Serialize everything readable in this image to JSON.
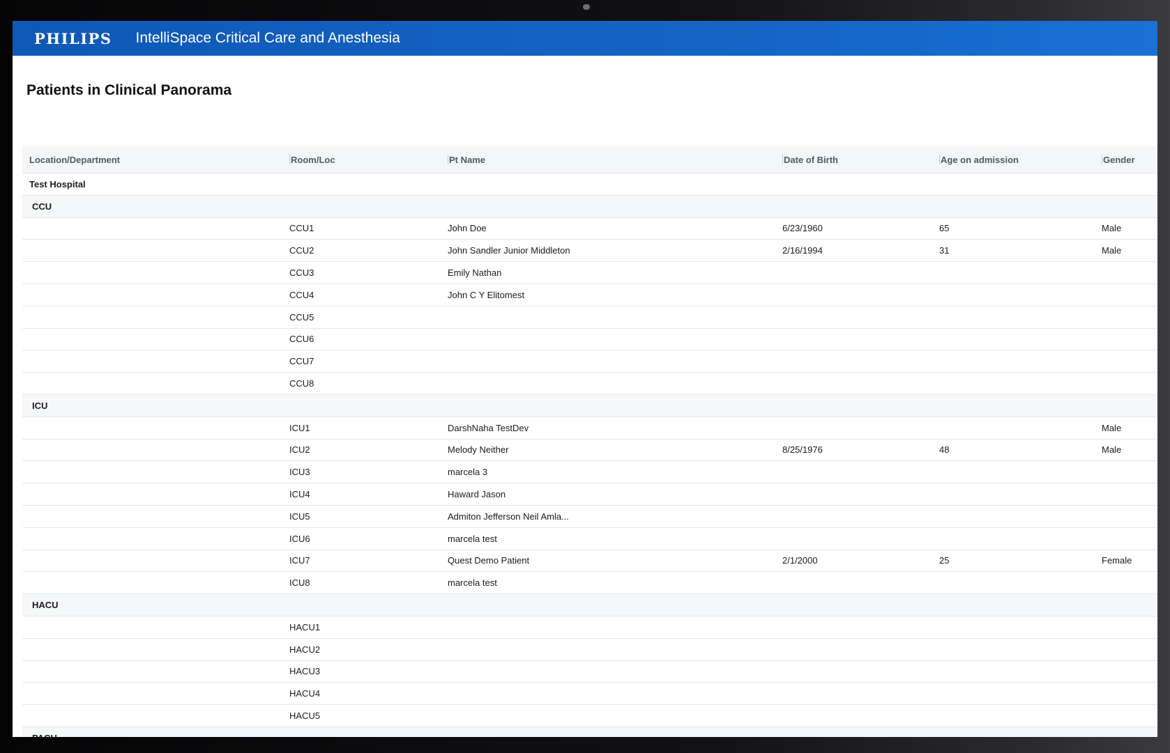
{
  "header": {
    "brand": "PHILIPS",
    "app_title": "IntelliSpace Critical Care and Anesthesia",
    "brand_color": "#1566c8"
  },
  "page_title": "Patients in Clinical Panorama",
  "table": {
    "columns": [
      "Location/Department",
      "Room/Loc",
      "Pt Name",
      "Date of Birth",
      "Age on admission",
      "Gender"
    ],
    "hospital": "Test Hospital",
    "groups": [
      {
        "name": "CCU",
        "rows": [
          {
            "room": "CCU1",
            "name": "John Doe",
            "dob": "6/23/1960",
            "age": "65",
            "gender": "Male"
          },
          {
            "room": "CCU2",
            "name": "John Sandler Junior Middleton",
            "dob": "2/16/1994",
            "age": "31",
            "gender": "Male"
          },
          {
            "room": "CCU3",
            "name": "Emily Nathan",
            "dob": "",
            "age": "",
            "gender": ""
          },
          {
            "room": "CCU4",
            "name": "John C Y Elitomest",
            "dob": "",
            "age": "",
            "gender": ""
          },
          {
            "room": "CCU5",
            "name": "",
            "dob": "",
            "age": "",
            "gender": ""
          },
          {
            "room": "CCU6",
            "name": "",
            "dob": "",
            "age": "",
            "gender": ""
          },
          {
            "room": "CCU7",
            "name": "",
            "dob": "",
            "age": "",
            "gender": ""
          },
          {
            "room": "CCU8",
            "name": "",
            "dob": "",
            "age": "",
            "gender": ""
          }
        ]
      },
      {
        "name": "ICU",
        "rows": [
          {
            "room": "ICU1",
            "name": "DarshNaha TestDev",
            "dob": "",
            "age": "",
            "gender": "Male"
          },
          {
            "room": "ICU2",
            "name": "Melody Neither",
            "dob": "8/25/1976",
            "age": "48",
            "gender": "Male"
          },
          {
            "room": "ICU3",
            "name": "marcela 3",
            "dob": "",
            "age": "",
            "gender": ""
          },
          {
            "room": "ICU4",
            "name": "Haward Jason",
            "dob": "",
            "age": "",
            "gender": ""
          },
          {
            "room": "ICU5",
            "name": "Admiton Jefferson Neil Amla...",
            "dob": "",
            "age": "",
            "gender": ""
          },
          {
            "room": "ICU6",
            "name": "marcela test",
            "dob": "",
            "age": "",
            "gender": ""
          },
          {
            "room": "ICU7",
            "name": "Quest Demo Patient",
            "dob": "2/1/2000",
            "age": "25",
            "gender": "Female"
          },
          {
            "room": "ICU8",
            "name": "marcela test",
            "dob": "",
            "age": "",
            "gender": ""
          }
        ]
      },
      {
        "name": "HACU",
        "rows": [
          {
            "room": "HACU1",
            "name": "",
            "dob": "",
            "age": "",
            "gender": ""
          },
          {
            "room": "HACU2",
            "name": "",
            "dob": "",
            "age": "",
            "gender": ""
          },
          {
            "room": "HACU3",
            "name": "",
            "dob": "",
            "age": "",
            "gender": ""
          },
          {
            "room": "HACU4",
            "name": "",
            "dob": "",
            "age": "",
            "gender": ""
          },
          {
            "room": "HACU5",
            "name": "",
            "dob": "",
            "age": "",
            "gender": ""
          }
        ]
      },
      {
        "name": "PACU",
        "rows": []
      }
    ]
  }
}
